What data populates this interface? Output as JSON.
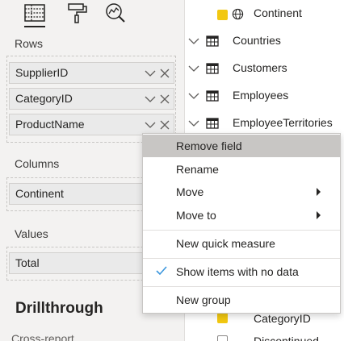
{
  "visualizations": {
    "tabs": [
      {
        "icon": "table-visual-icon"
      },
      {
        "icon": "paint-roller-icon"
      },
      {
        "icon": "analytics-magnifier-icon"
      }
    ]
  },
  "wells": {
    "rows_label": "Rows",
    "rows_fields": [
      "SupplierID",
      "CategoryID",
      "ProductName"
    ],
    "columns_label": "Columns",
    "columns_fields": [
      "Continent"
    ],
    "values_label": "Values",
    "values_fields": [
      "Total"
    ]
  },
  "drillthrough": {
    "title": "Drillthrough",
    "cross_report_label": "Cross-report"
  },
  "fields_pane": {
    "top_item": "Continent",
    "tables": [
      "Countries",
      "Customers",
      "Employees",
      "EmployeeTerritories"
    ],
    "lower_items": [
      "CategoryID",
      "Discontinued"
    ]
  },
  "context_menu": {
    "items": [
      {
        "label": "Remove field"
      },
      {
        "label": "Rename"
      },
      {
        "label": "Move"
      },
      {
        "label": "Move to"
      },
      {
        "label": "New quick measure"
      },
      {
        "label": "Show items with no data"
      },
      {
        "label": "New group"
      }
    ],
    "hovered": "Remove field"
  },
  "colors": {
    "checkbox_accent": "#f2c811",
    "checkmark_accent": "#3a96dd",
    "menu_hover": "#c8c6c4"
  }
}
